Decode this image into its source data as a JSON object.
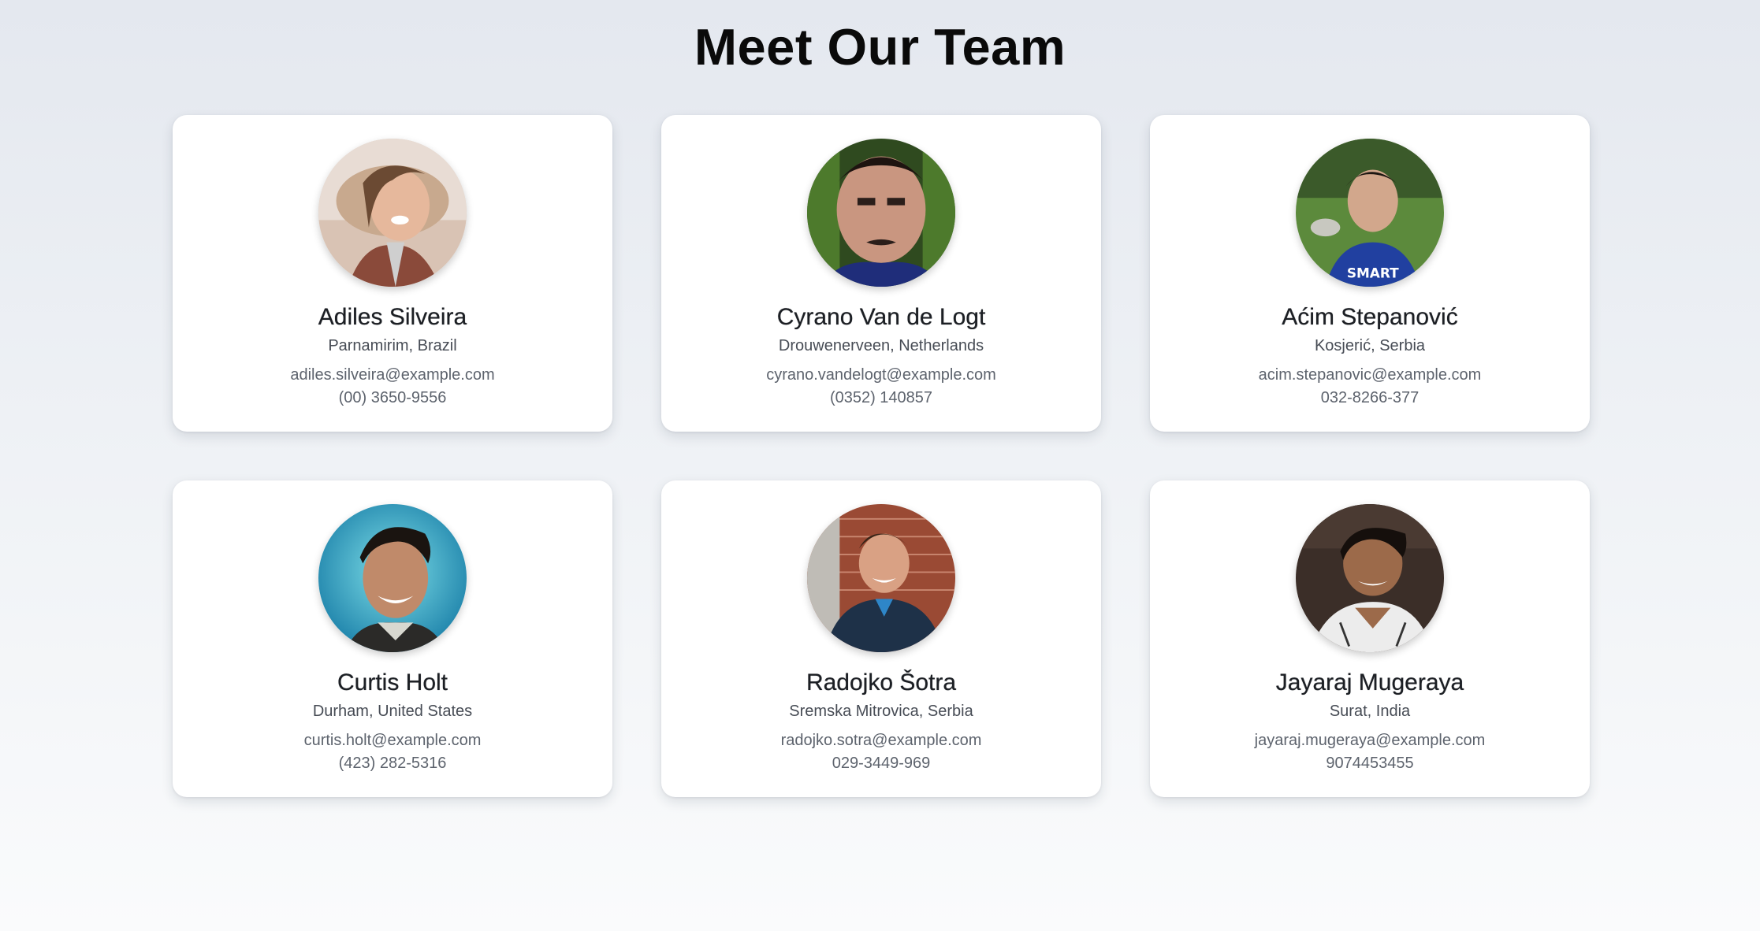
{
  "page": {
    "title": "Meet Our Team"
  },
  "members": [
    {
      "name": "Adiles Silveira",
      "location": "Parnamirim, Brazil",
      "email": "adiles.silveira@example.com",
      "phone": "(00) 3650-9556",
      "avatar_icon": "person-photo"
    },
    {
      "name": "Cyrano Van de Logt",
      "location": "Drouwenerveen, Netherlands",
      "email": "cyrano.vandelogt@example.com",
      "phone": "(0352) 140857",
      "avatar_icon": "person-photo"
    },
    {
      "name": "Aćim Stepanović",
      "location": "Kosjerić, Serbia",
      "email": "acim.stepanovic@example.com",
      "phone": "032-8266-377",
      "avatar_icon": "person-photo"
    },
    {
      "name": "Curtis Holt",
      "location": "Durham, United States",
      "email": "curtis.holt@example.com",
      "phone": "(423) 282-5316",
      "avatar_icon": "person-photo"
    },
    {
      "name": "Radojko Šotra",
      "location": "Sremska Mitrovica, Serbia",
      "email": "radojko.sotra@example.com",
      "phone": "029-3449-969",
      "avatar_icon": "person-photo"
    },
    {
      "name": "Jayaraj Mugeraya",
      "location": "Surat, India",
      "email": "jayaraj.mugeraya@example.com",
      "phone": "9074453455",
      "avatar_icon": "person-photo"
    }
  ],
  "colors": {
    "card_background": "#ffffff",
    "title_text": "#0a0a0a"
  }
}
